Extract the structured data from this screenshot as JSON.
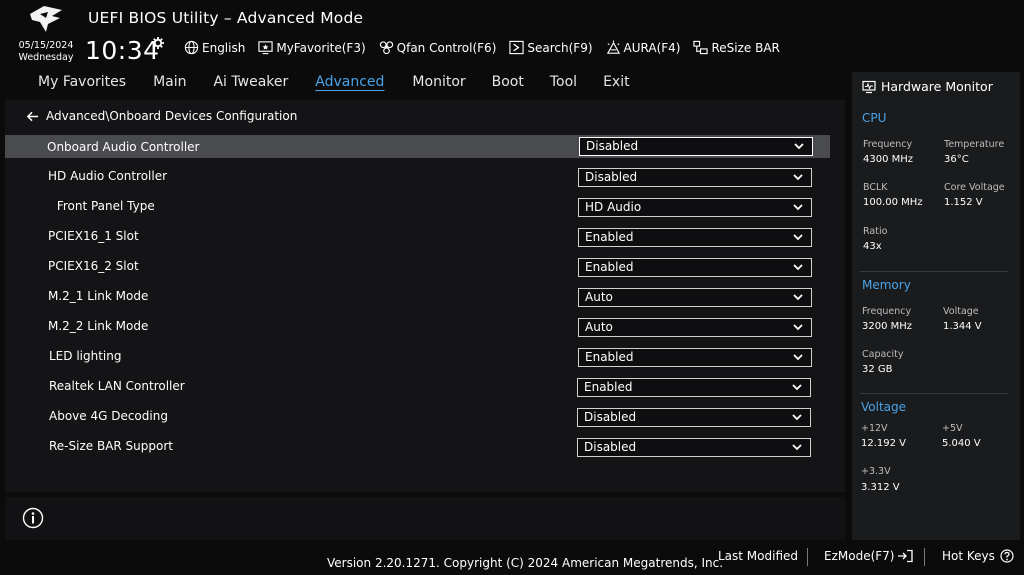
{
  "header": {
    "title": "UEFI BIOS Utility – Advanced Mode",
    "date": "05/15/2024",
    "day": "Wednesday",
    "time": "10:34",
    "toolbar": [
      {
        "label": "English",
        "icon": "globe-icon"
      },
      {
        "label": "MyFavorite(F3)",
        "icon": "favorite-monitor-icon"
      },
      {
        "label": "Qfan Control(F6)",
        "icon": "fan-icon"
      },
      {
        "label": "Search(F9)",
        "icon": "search-icon"
      },
      {
        "label": "AURA(F4)",
        "icon": "aura-light-icon"
      },
      {
        "label": "ReSize BAR",
        "icon": "resize-bar-icon"
      }
    ]
  },
  "tabs": [
    {
      "label": "My Favorites",
      "active": false
    },
    {
      "label": "Main",
      "active": false
    },
    {
      "label": "Ai Tweaker",
      "active": false
    },
    {
      "label": "Advanced",
      "active": true
    },
    {
      "label": "Monitor",
      "active": false
    },
    {
      "label": "Boot",
      "active": false
    },
    {
      "label": "Tool",
      "active": false
    },
    {
      "label": "Exit",
      "active": false
    }
  ],
  "breadcrumb": "Advanced\\Onboard Devices Configuration",
  "settings": [
    {
      "label": "Onboard Audio Controller",
      "value": "Disabled",
      "selected": true
    },
    {
      "label": "HD Audio Controller",
      "value": "Disabled",
      "selected": false
    },
    {
      "label": " Front Panel Type",
      "value": "HD Audio",
      "selected": false
    },
    {
      "label": "PCIEX16_1 Slot",
      "value": "Enabled",
      "selected": false
    },
    {
      "label": "PCIEX16_2 Slot",
      "value": "Enabled",
      "selected": false
    },
    {
      "label": "M.2_1 Link Mode",
      "value": "Auto",
      "selected": false
    },
    {
      "label": "M.2_2 Link Mode",
      "value": "Auto",
      "selected": false
    },
    {
      "label": "LED lighting",
      "value": "Enabled",
      "selected": false
    },
    {
      "label": "Realtek LAN Controller",
      "value": "Enabled",
      "selected": false
    },
    {
      "label": "Above 4G Decoding",
      "value": "Disabled",
      "selected": false
    },
    {
      "label": "Re-Size BAR Support",
      "value": "Disabled",
      "selected": false
    }
  ],
  "hardware_monitor": {
    "title": "Hardware Monitor",
    "cpu": {
      "heading": "CPU",
      "frequency_label": "Frequency",
      "frequency": "4300 MHz",
      "temperature_label": "Temperature",
      "temperature": "36°C",
      "bclk_label": "BCLK",
      "bclk": "100.00 MHz",
      "core_voltage_label": "Core Voltage",
      "core_voltage": "1.152 V",
      "ratio_label": "Ratio",
      "ratio": "43x"
    },
    "memory": {
      "heading": "Memory",
      "frequency_label": "Frequency",
      "frequency": "3200 MHz",
      "voltage_label": "Voltage",
      "voltage": "1.344 V",
      "capacity_label": "Capacity",
      "capacity": "32 GB"
    },
    "voltage": {
      "heading": "Voltage",
      "v12_label": "+12V",
      "v12": "12.192 V",
      "v5_label": "+5V",
      "v5": "5.040 V",
      "v33_label": "+3.3V",
      "v33": "3.312 V"
    }
  },
  "footer": {
    "version": "Version 2.20.1271. Copyright (C) 2024 American Megatrends, Inc.",
    "last_modified": "Last Modified",
    "ezmode": "EzMode(F7)",
    "hot_keys": "Hot Keys"
  },
  "colors": {
    "accent": "#4aa3e8",
    "background": "#0b0b0c",
    "panel": "#141416",
    "selected_row": "#4a4b4e"
  }
}
